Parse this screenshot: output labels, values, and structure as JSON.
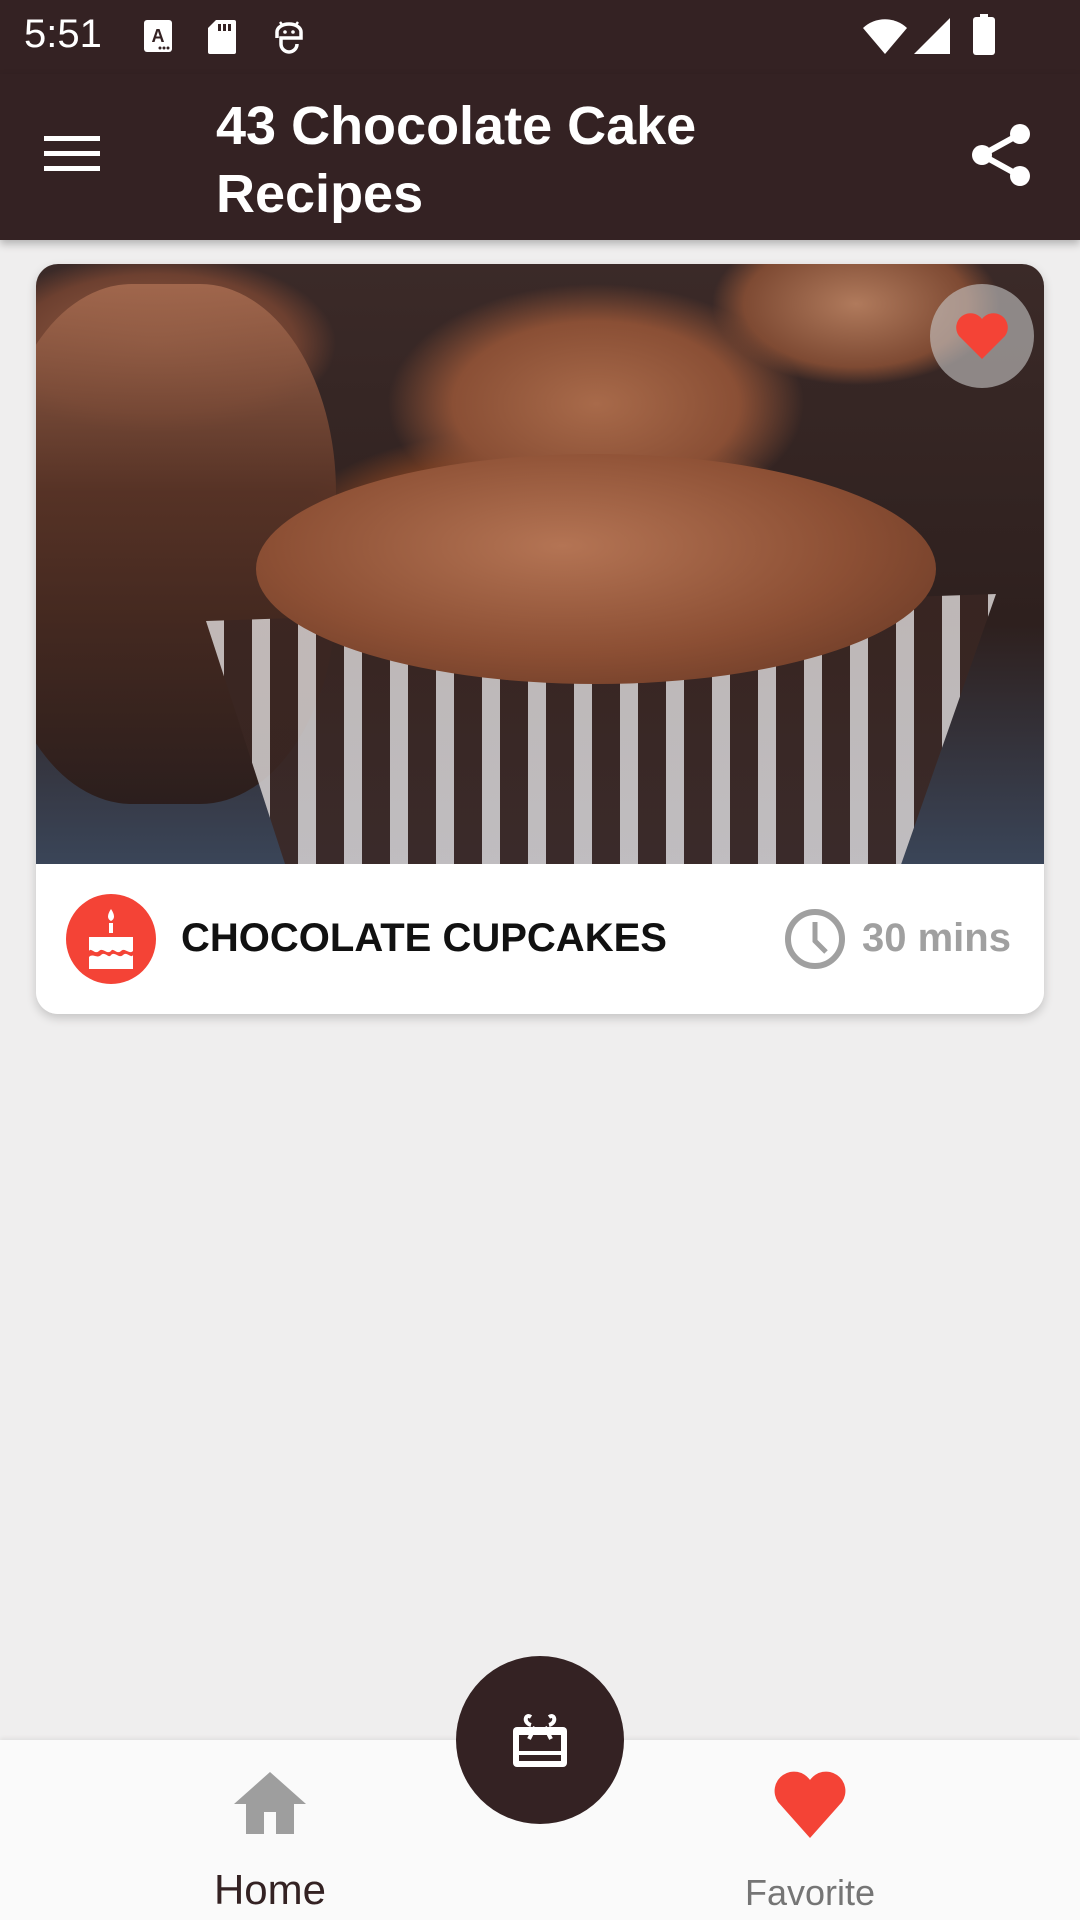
{
  "status_bar": {
    "time": "5:51",
    "left_icons": [
      "font-a-icon",
      "sd-card-icon",
      "android-debug-icon"
    ],
    "right_icons": [
      "wifi-icon",
      "cell-signal-icon",
      "battery-icon"
    ]
  },
  "app_bar": {
    "title": "43 Chocolate Cake Recipes",
    "menu_icon": "hamburger-menu-icon",
    "share_icon": "share-icon"
  },
  "recipes": [
    {
      "name": "CHOCOLATE CUPCAKES",
      "time": "30 mins",
      "favorited": true,
      "category_icon": "cake-icon",
      "time_icon": "clock-icon",
      "image_alt": "Chocolate cupcake with chocolate frosting"
    }
  ],
  "fab": {
    "icon": "gift-cake-icon"
  },
  "bottom_nav": {
    "items": [
      {
        "label": "Home",
        "icon": "home-icon",
        "active": true
      },
      {
        "label": "Favorite",
        "icon": "heart-icon",
        "active": false
      }
    ]
  },
  "colors": {
    "primary": "#342223",
    "accent": "#f44336",
    "background": "#efeeee",
    "muted_text": "#a0a0a0"
  }
}
